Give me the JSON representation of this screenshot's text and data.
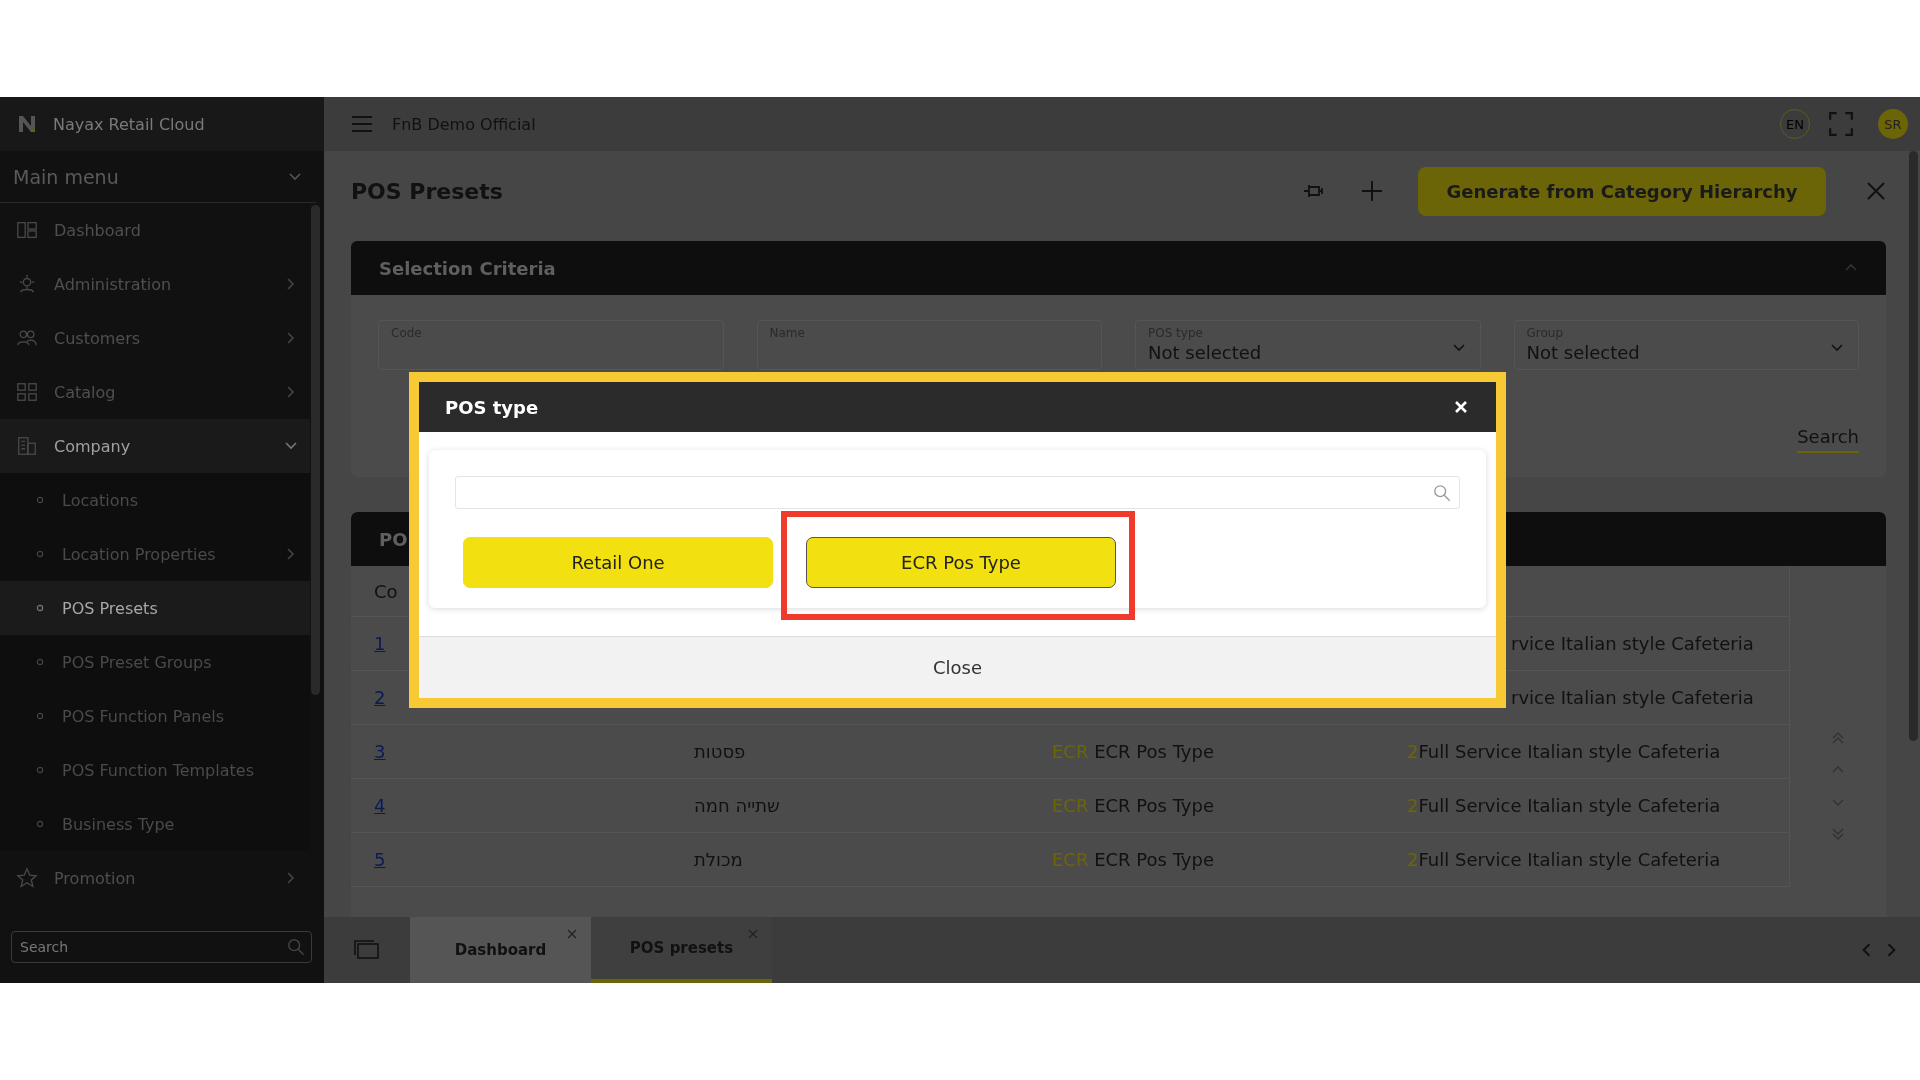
{
  "app": {
    "brand": "Nayax Retail Cloud",
    "org": "FnB Demo Official",
    "language": "EN",
    "user_initials": "SR"
  },
  "sidebar": {
    "menu_title": "Main menu",
    "items": [
      {
        "label": "Dashboard"
      },
      {
        "label": "Administration",
        "expanded": false
      },
      {
        "label": "Customers",
        "expanded": false
      },
      {
        "label": "Catalog",
        "expanded": false
      },
      {
        "label": "Company",
        "expanded": true,
        "children": [
          {
            "label": "Locations",
            "selected": false
          },
          {
            "label": "Location Properties",
            "selected": false,
            "expanded": false
          },
          {
            "label": "POS Presets",
            "selected": true
          },
          {
            "label": "POS Preset Groups",
            "selected": false
          },
          {
            "label": "POS Function Panels",
            "selected": false
          },
          {
            "label": "POS Function Templates",
            "selected": false
          },
          {
            "label": "Business Type",
            "selected": false
          }
        ]
      },
      {
        "label": "Promotion",
        "expanded": false
      }
    ],
    "search": {
      "placeholder": "Search"
    }
  },
  "page": {
    "title": "POS Presets",
    "primary_action": "Generate from Category Hierarchy"
  },
  "criteria": {
    "title": "Selection Criteria",
    "expanded": true,
    "fields": [
      {
        "kind": "text",
        "label": "Code"
      },
      {
        "kind": "text",
        "label": "Name"
      },
      {
        "kind": "select",
        "label": "POS type",
        "value": "Not selected"
      },
      {
        "kind": "select",
        "label": "Group",
        "value": "Not selected"
      }
    ],
    "search_link": "Search"
  },
  "table": {
    "title": "PO",
    "columns": [
      "Co"
    ],
    "rows": [
      {
        "kind": "covered",
        "code": "1",
        "group": "rvice Italian style Cafeteria"
      },
      {
        "kind": "covered",
        "code": "2",
        "group": "rvice Italian style Cafeteria"
      },
      {
        "kind": "full",
        "code": "3",
        "name": "פסטות",
        "pos_code": "ECR",
        "pos_type": "ECR Pos Type",
        "group_code": "2",
        "group": "Full Service Italian style Cafeteria"
      },
      {
        "kind": "full",
        "code": "4",
        "name": "שתייה חמה",
        "pos_code": "ECR",
        "pos_type": "ECR Pos Type",
        "group_code": "2",
        "group": "Full Service Italian style Cafeteria"
      },
      {
        "kind": "full",
        "code": "5",
        "name": "מכולת",
        "pos_code": "ECR",
        "pos_type": "ECR Pos Type",
        "group_code": "2",
        "group": "Full Service Italian style Cafeteria"
      }
    ]
  },
  "modal": {
    "title": "POS type",
    "options": [
      {
        "label": "Retail One",
        "selected": false
      },
      {
        "label": "ECR Pos Type",
        "selected": true
      }
    ],
    "close": "Close"
  },
  "tabs": [
    {
      "label": "Dashboard",
      "selected": false
    },
    {
      "label": "POS presets",
      "selected": true
    }
  ]
}
